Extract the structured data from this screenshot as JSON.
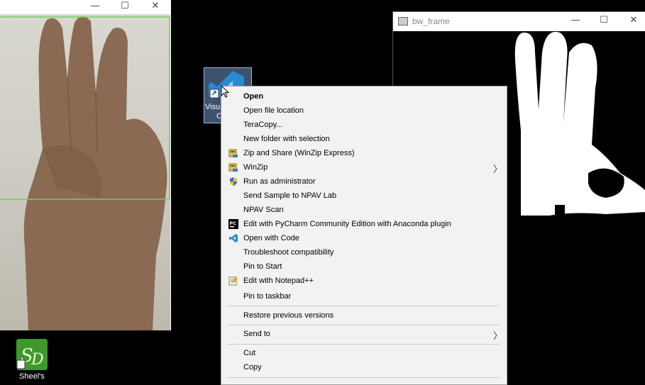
{
  "left_window": {
    "buttons": {
      "minimize": "—",
      "maximize": "☐",
      "close": "✕"
    }
  },
  "right_window": {
    "title": "bw_frame",
    "buttons": {
      "minimize": "—",
      "maximize": "☐",
      "close": "✕"
    }
  },
  "desktop": {
    "vscode_label": "Visua",
    "vscode_label2": "C",
    "sd_label": "Sheel's"
  },
  "menu": {
    "items": [
      {
        "label": "Open",
        "icon": "",
        "submenu": false
      },
      {
        "label": "Open file location",
        "icon": "",
        "submenu": false
      },
      {
        "label": "TeraCopy...",
        "icon": "",
        "submenu": false
      },
      {
        "label": "New folder with selection",
        "icon": "",
        "submenu": false
      },
      {
        "label": "Zip and Share (WinZip Express)",
        "icon": "winzip-icon",
        "submenu": false
      },
      {
        "label": "WinZip",
        "icon": "winzip-icon",
        "submenu": true
      },
      {
        "label": "Run as administrator",
        "icon": "shield-icon",
        "submenu": false
      },
      {
        "label": "Send Sample to NPAV Lab",
        "icon": "",
        "submenu": false
      },
      {
        "label": "NPAV Scan",
        "icon": "",
        "submenu": false
      },
      {
        "label": "Edit with PyCharm Community Edition with Anaconda plugin",
        "icon": "pycharm-icon",
        "submenu": false
      },
      {
        "label": "Open with Code",
        "icon": "vscode-icon",
        "submenu": false
      },
      {
        "label": "Troubleshoot compatibility",
        "icon": "",
        "submenu": false
      },
      {
        "label": "Pin to Start",
        "icon": "",
        "submenu": false
      },
      {
        "label": "Edit with Notepad++",
        "icon": "notepadpp-icon",
        "submenu": false
      },
      {
        "label": "Pin to taskbar",
        "icon": "",
        "submenu": false
      },
      {
        "label": "Restore previous versions",
        "icon": "",
        "submenu": false
      },
      {
        "label": "Send to",
        "icon": "",
        "submenu": true
      },
      {
        "label": "Cut",
        "icon": "",
        "submenu": false
      },
      {
        "label": "Copy",
        "icon": "",
        "submenu": false
      }
    ],
    "submenu_arrow": "〉"
  },
  "colors": {
    "menu_bg": "#f2f2f2",
    "roi_border": "#6fcf5b",
    "sd_green": "#3d9a2a",
    "vscode_blue": "#2a8ad4"
  }
}
